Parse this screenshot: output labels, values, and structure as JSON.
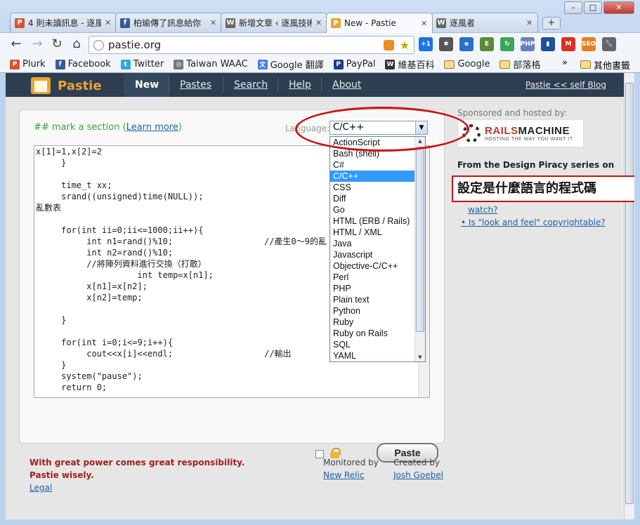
{
  "browser": {
    "tabs": [
      {
        "title": "4 則未讀訊息 - 逐風",
        "favicon": "plurk-icon",
        "color": "#d9532c",
        "glyph": "P"
      },
      {
        "title": "柏瑜傳了訊息給你",
        "favicon": "facebook-icon",
        "color": "#3b5998",
        "glyph": "f"
      },
      {
        "title": "新增文章 ‹ 逐風技術",
        "favicon": "wordpress-icon",
        "color": "#666666",
        "glyph": "W"
      },
      {
        "title": "New - Pastie",
        "favicon": "pastie-icon",
        "color": "#e8a630",
        "glyph": "P"
      },
      {
        "title": "逐風者",
        "favicon": "wordpress-icon",
        "color": "#666666",
        "glyph": "W"
      }
    ],
    "new_tab": "+",
    "url": "pastie.org",
    "bookmarks": [
      {
        "label": "Plurk",
        "icon": "plurk-icon",
        "color": "#d9532c",
        "glyph": "P"
      },
      {
        "label": "Facebook",
        "icon": "facebook-icon",
        "color": "#3b5998",
        "glyph": "f"
      },
      {
        "label": "Twitter",
        "icon": "twitter-icon",
        "color": "#33a6dd",
        "glyph": "t"
      },
      {
        "label": "Taiwan WAAC",
        "icon": "globe-icon",
        "color": "#777777",
        "glyph": "◎"
      },
      {
        "label": "Google 翻譯",
        "icon": "translate-icon",
        "color": "#4a7be0",
        "glyph": "文"
      },
      {
        "label": "PayPal",
        "icon": "paypal-icon",
        "color": "#1e3d8f",
        "glyph": "P"
      },
      {
        "label": "維基百科",
        "icon": "wikipedia-icon",
        "color": "#333333",
        "glyph": "W"
      },
      {
        "label": "Google",
        "icon": "folder-icon",
        "color": "",
        "glyph": ""
      },
      {
        "label": "部落格",
        "icon": "folder-icon",
        "color": "",
        "glyph": ""
      }
    ],
    "bookmarks_more": "»",
    "other_bookmarks": "其他書籤",
    "extensions": [
      {
        "name": "plus-one-icon",
        "color": "#1a73e8",
        "glyph": "+1"
      },
      {
        "name": "bug-icon",
        "color": "#555555",
        "glyph": "✱"
      },
      {
        "name": "ie-tab-icon",
        "color": "#2a6fc9",
        "glyph": "e"
      },
      {
        "name": "evernote-icon",
        "color": "#5a8a3a",
        "glyph": "E"
      },
      {
        "name": "refresh-ext-icon",
        "color": "#3aa55a",
        "glyph": "↻"
      },
      {
        "name": "php-icon",
        "color": "#6c7eb7",
        "glyph": "PHP"
      },
      {
        "name": "chart-icon",
        "color": "#1f4f99",
        "glyph": "▮"
      },
      {
        "name": "gmail-icon",
        "color": "#d93025",
        "glyph": "M"
      },
      {
        "name": "seo-icon",
        "color": "#e67e22",
        "glyph": "SEO"
      },
      {
        "name": "wrench-icon",
        "color": "#666666",
        "glyph": "🔧"
      }
    ]
  },
  "site": {
    "logo": "Pastie",
    "nav": [
      "New",
      "Pastes",
      "Search",
      "Help",
      "About"
    ],
    "blog_link": "Pastie << self Blog"
  },
  "editor": {
    "mark_prefix": "## mark a section (",
    "learn_more": "Learn more",
    "mark_suffix": ")",
    "language_label": "Language:",
    "language_selected": "C/C++",
    "code": "x[1]=1,x[2]=2\n     }\n\n     time_t xx;\n     srand((unsigned)time(NULL));\n亂數表\n\n     for(int ii=0;ii<=1000;ii++){\n          int n1=rand()%10;                  //產生0～9的亂\n          int n2=rand()%10;\n          //將陣列資料進行交換（打散）\n                    int temp=x[n1];\n          x[n1]=x[n2];\n          x[n2]=temp;\n\n     }\n\n     for(int i=0;i<=9;i++){\n          cout<<x[i]<<endl;                  //輸出\n     }\n     system(\"pause\");\n     return 0;",
    "paste_button": "Paste",
    "languages": [
      "ActionScript",
      "Bash (shell)",
      "C#",
      "C/C++",
      "CSS",
      "Diff",
      "Go",
      "HTML (ERB / Rails)",
      "HTML / XML",
      "Java",
      "Javascript",
      "Objective-C/C++",
      "Perl",
      "PHP",
      "Plain text",
      "Python",
      "Ruby",
      "Ruby on Rails",
      "SQL",
      "YAML"
    ]
  },
  "sidebar": {
    "sponsored": "Sponsored and hosted by:",
    "rails_left": "RAILS",
    "rails_right": "MACHINE",
    "rails_tagline": "HOSTING THE WAY YOU WANT IT",
    "piracy_heading": "From the Design Piracy series on",
    "links": [
      "watch?",
      "Is \"look and feel\" copyrightable?"
    ]
  },
  "annotation": "設定是什麼語言的程式碼",
  "footer": {
    "line1": "With great power comes great responsibility.",
    "line2": "Pastie wisely.",
    "legal": "Legal",
    "monitored_by": "Monitored by",
    "new_relic": "New Relic",
    "created_by": "Created by",
    "author": "Josh Goebel"
  }
}
